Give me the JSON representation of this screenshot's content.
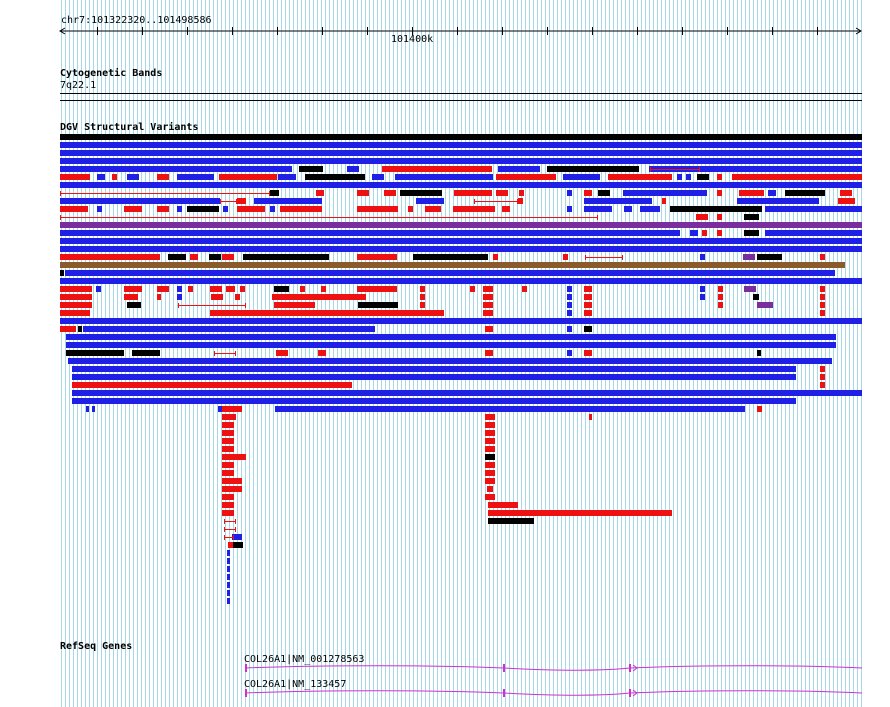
{
  "ruler": {
    "coordinates": "chr7:101322320..101498586",
    "center_tick_label": "101400k"
  },
  "tracks": {
    "cytoband": {
      "title": "Cytogenetic Bands",
      "band_label": "7q22.1"
    },
    "dgv": {
      "title": "DGV Structural Variants",
      "colors": {
        "gain": "#1f1fe6",
        "loss": "#ee1111",
        "gain_loss": "#000000",
        "complex": "#7a2d9c",
        "inversion": "#8b5a2b"
      }
    },
    "refseq": {
      "title": "RefSeq Genes",
      "color": "#cc33cc",
      "genes": [
        {
          "label": "COL26A1|NM_001278563"
        },
        {
          "label": "COL26A1|NM_133457"
        }
      ]
    }
  },
  "grid_color": "#a8d8e8"
}
